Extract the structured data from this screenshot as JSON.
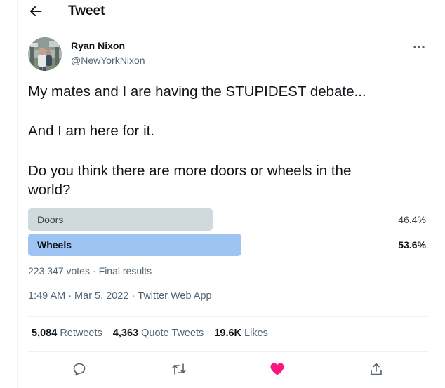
{
  "header": {
    "title": "Tweet",
    "back_icon": "arrow-left-icon"
  },
  "author": {
    "name": "Ryan Nixon",
    "handle": "@NewYorkNixon"
  },
  "tweet": {
    "line1": "My mates and I are having the STUPIDEST debate...",
    "line2": "And I am here for it.",
    "line3": "Do you think there are more doors or wheels in the",
    "line4": "world?"
  },
  "poll": {
    "options": [
      {
        "label": "Doors",
        "percent_text": "46.4%",
        "percent": 46.4,
        "winner": false
      },
      {
        "label": "Wheels",
        "percent_text": "53.6%",
        "percent": 53.6,
        "winner": true
      }
    ],
    "votes": "223,347 votes",
    "status": "Final results"
  },
  "meta": {
    "time": "1:49 AM",
    "date": "Mar 5, 2022",
    "source": "Twitter Web App"
  },
  "stats": {
    "retweets_count": "5,084",
    "retweets_label": "Retweets",
    "quotes_count": "4,363",
    "quotes_label": "Quote Tweets",
    "likes_count": "19.6K",
    "likes_label": "Likes"
  },
  "actions": [
    "reply-icon",
    "retweet-icon",
    "like-icon",
    "share-icon"
  ],
  "colors": {
    "text_primary": "#0f1419",
    "text_secondary": "#536471",
    "poll_winner": "#9ec4f3",
    "poll_other": "#cfd9de",
    "like_active": "#f91880",
    "icon_gray": "#536471"
  },
  "dot": "·"
}
